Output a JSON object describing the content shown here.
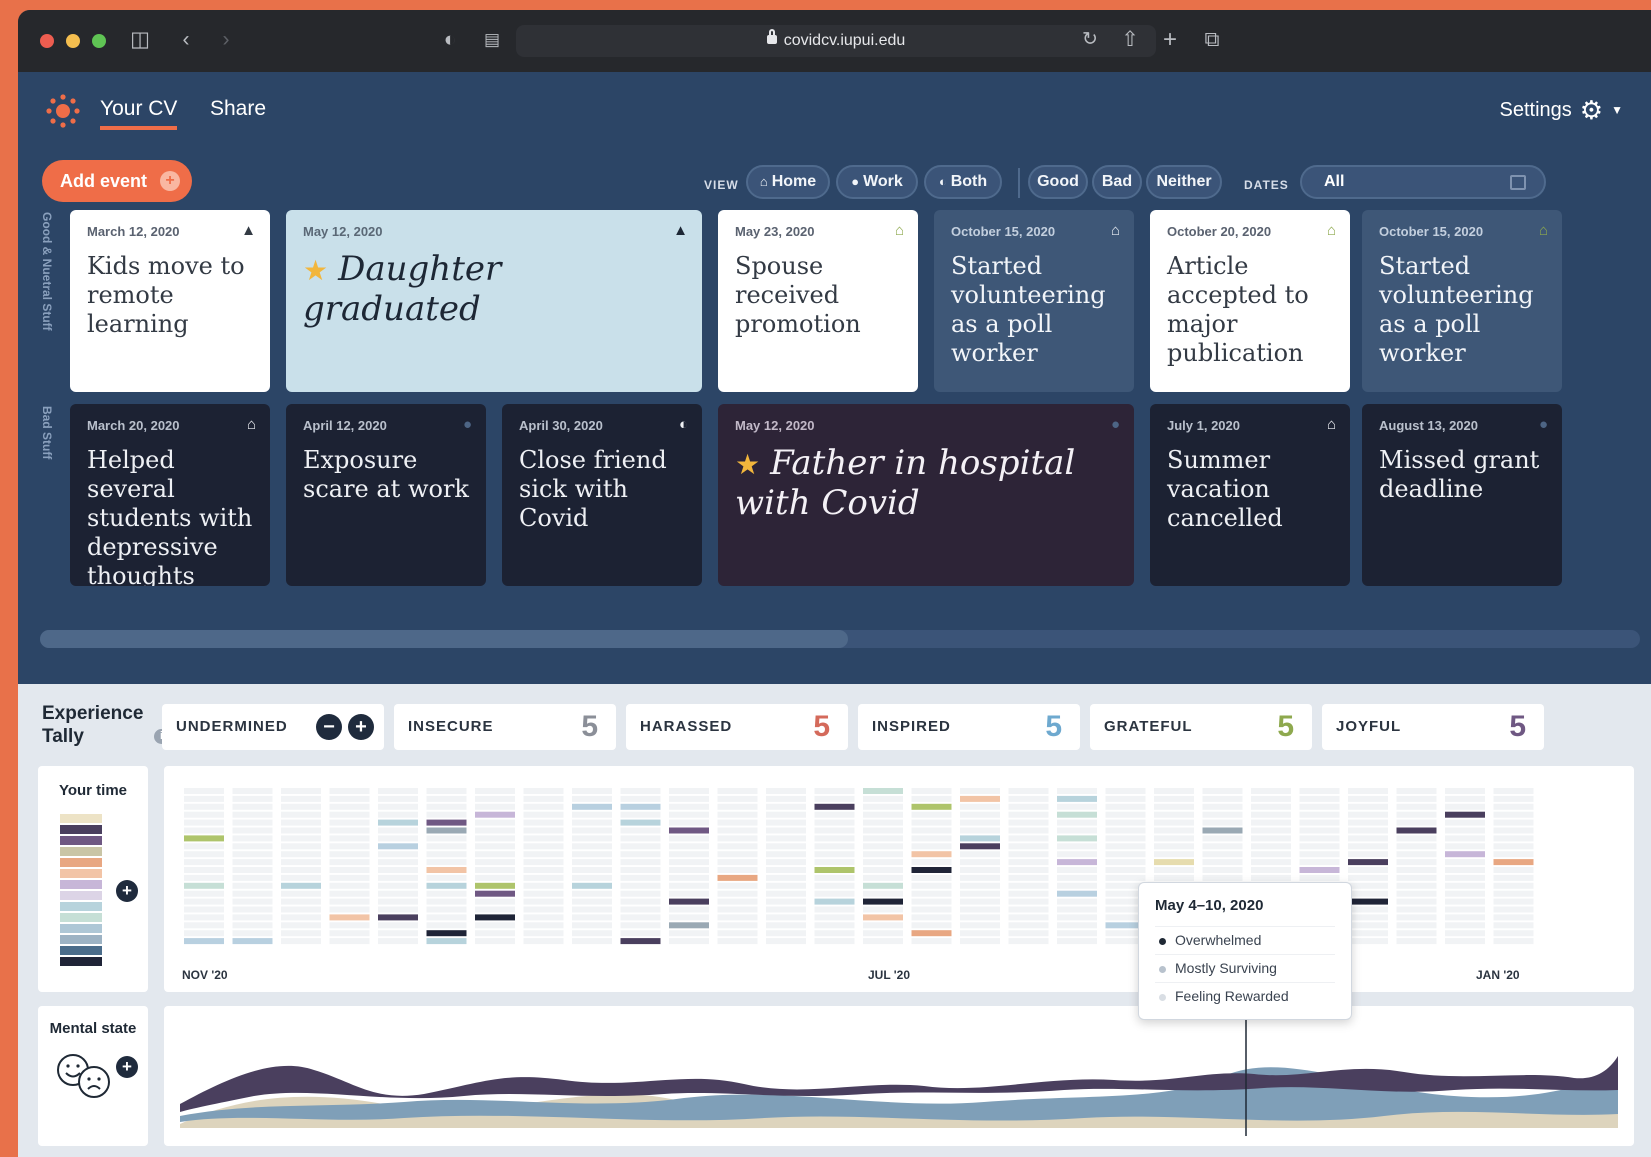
{
  "browser": {
    "url": "covidcv.iupui.edu"
  },
  "nav": {
    "tabs": [
      {
        "label": "Your CV"
      },
      {
        "label": "Share"
      }
    ],
    "settings_label": "Settings"
  },
  "toolbar": {
    "add_event_label": "Add event",
    "view_label": "VIEW",
    "view_options": [
      "Home",
      "Work",
      "Both"
    ],
    "mood_options": [
      "Good",
      "Bad",
      "Neither"
    ],
    "dates_label": "DATES",
    "dates_value": "All"
  },
  "row_labels": {
    "good": "Good & Nuetral Stuff",
    "bad": "Bad Stuff"
  },
  "good_events": [
    {
      "date": "March 12, 2020",
      "title": "Kids move to remote learning",
      "icon": "graduation-cap-icon"
    },
    {
      "date": "May 12, 2020",
      "title": "Daughter graduated",
      "icon": "graduation-cap-icon",
      "starred": true
    },
    {
      "date": "May 23, 2020",
      "title": "Spouse received promotion",
      "icon": "home-icon"
    },
    {
      "date": "October 15, 2020",
      "title": "Started volunteering as a poll worker",
      "icon": "home-icon"
    },
    {
      "date": "October 20, 2020",
      "title": "Article accepted to major publication",
      "icon": "home-icon"
    },
    {
      "date": "October 15, 2020",
      "title": "Started volunteering as a poll worker",
      "icon": "home-icon"
    }
  ],
  "bad_events": [
    {
      "date": "March 20, 2020",
      "title": "Helped several students with depressive thoughts",
      "icon": "home-icon"
    },
    {
      "date": "April 12, 2020",
      "title": "Exposure scare at work",
      "icon": "work-icon"
    },
    {
      "date": "April 30, 2020",
      "title": "Close friend sick with Covid",
      "icon": "both-icon"
    },
    {
      "date": "May 12, 2020",
      "title": "Father in hospital with Covid",
      "icon": "work-icon",
      "starred": true
    },
    {
      "date": "July 1, 2020",
      "title": "Summer vacation cancelled",
      "icon": "home-icon"
    },
    {
      "date": "August 13, 2020",
      "title": "Missed grant deadline",
      "icon": "work-icon"
    }
  ],
  "tally": {
    "title": "Experience Tally",
    "items": [
      {
        "label": "UNDERMINED"
      },
      {
        "label": "INSECURE",
        "count": "5",
        "color": "#8b8f98"
      },
      {
        "label": "HARASSED",
        "count": "5",
        "color": "#d46a5b"
      },
      {
        "label": "INSPIRED",
        "count": "5",
        "color": "#6ea9cf"
      },
      {
        "label": "GRATEFUL",
        "count": "5",
        "color": "#8ea94e"
      },
      {
        "label": "JOYFUL",
        "count": "5",
        "color": "#6f5883"
      }
    ]
  },
  "your_time": {
    "title": "Your time",
    "axis_start": "NOV '20",
    "axis_mid": "JUL '20",
    "axis_end": "JAN '20"
  },
  "tooltip": {
    "title": "May 4–10, 2020",
    "items": [
      {
        "label": "Overwhelmed",
        "dot": "#1f2935"
      },
      {
        "label": "Mostly Surviving",
        "dot": "#b8c2cd"
      },
      {
        "label": "Feeling Rewarded",
        "dot": "#d9dee4"
      }
    ]
  },
  "mental_state": {
    "title": "Mental state"
  },
  "colors": {
    "accent": "#ef6d48",
    "header_bg": "#2c4566",
    "stream_dark": "#4a3f5e",
    "stream_blue": "#7f9fb8",
    "stream_cream": "#ddd4bd"
  }
}
